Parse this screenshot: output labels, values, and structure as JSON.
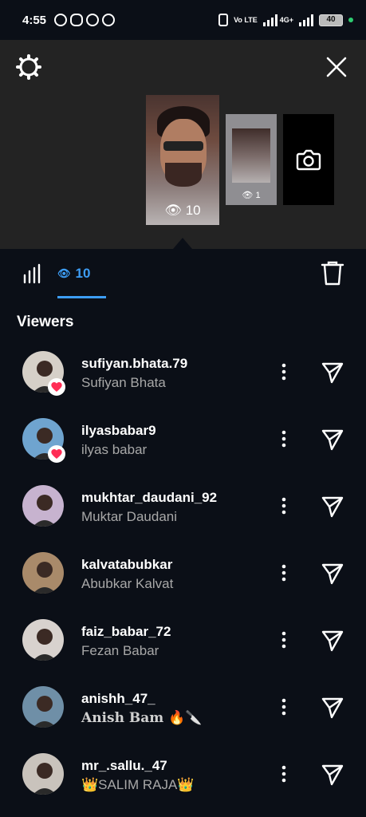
{
  "status_bar": {
    "time": "4:55",
    "network_label": "Vo LTE",
    "network_type": "4G+",
    "battery": "40",
    "icons": [
      "whatsapp-icon",
      "snapchat-icon",
      "whatsapp-business-icon",
      "messenger-icon"
    ]
  },
  "story_strip": {
    "main_story_views": "10",
    "second_story_views": "1",
    "camera_icon": "camera-icon"
  },
  "tabs": {
    "viewers_count": "10",
    "active_tab": "viewers"
  },
  "section_title": "Viewers",
  "viewers": [
    {
      "username": "sufiyan.bhata.79",
      "fullname": "Sufiyan Bhata",
      "liked": true,
      "avatar_color": "#d6d0c8"
    },
    {
      "username": "ilyasbabar9",
      "fullname": "ilyas babar",
      "liked": true,
      "avatar_color": "#6fa4cf"
    },
    {
      "username": "mukhtar_daudani_92",
      "fullname": "Muktar Daudani",
      "liked": false,
      "avatar_color": "#c7b3cf"
    },
    {
      "username": "kalvatabubkar",
      "fullname": "Abubkar Kalvat",
      "liked": false,
      "avatar_color": "#a98a6a"
    },
    {
      "username": "faiz_babar_72",
      "fullname": "Fezan Babar",
      "liked": false,
      "avatar_color": "#d8d2ce"
    },
    {
      "username": "anishh_47_",
      "fullname": "Anish  Bam 🔥🔪",
      "liked": false,
      "avatar_color": "#6f8fa7"
    },
    {
      "username": "mr_.sallu._47",
      "fullname": "👑SALIM RAJA👑",
      "liked": false,
      "avatar_color": "#c9c3bc"
    }
  ],
  "colors": {
    "background": "#0b0f17",
    "header_bg": "#232323",
    "accent": "#3d9df5",
    "like_red": "#ff2d55",
    "secondary_text": "#a8a8a8"
  }
}
